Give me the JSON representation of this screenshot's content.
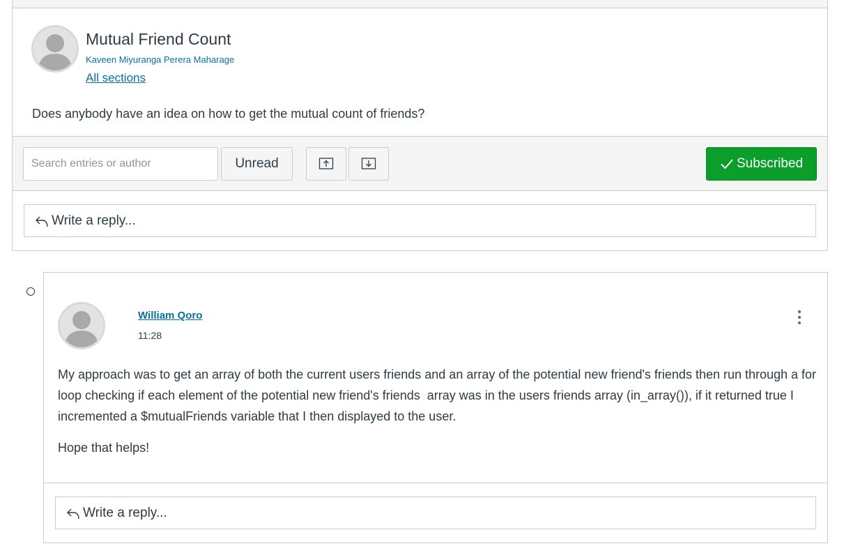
{
  "topic": {
    "title": "Mutual Friend Count",
    "author": "Kaveen Miyuranga Perera Maharage",
    "sections_link": "All sections",
    "message": "Does anybody have an idea on how to get the mutual count of friends?"
  },
  "toolbar": {
    "search_placeholder": "Search entries or author",
    "unread_label": "Unread",
    "subscribed_label": "Subscribed",
    "subscribed_color": "#0b9e2a"
  },
  "topic_reply": {
    "label": "Write a reply..."
  },
  "entry": {
    "author": "William Qoro",
    "time": "11:28",
    "paragraphs": [
      "My approach was to get an array of both the current users friends and an array of the potential new friend's friends then run through a for loop checking if each element of the potential new friend's friends  array was in the users friends array (in_array()), if it returned true I incremented a $mutualFriends variable that I then displayed to the user.",
      "Hope that helps!"
    ],
    "reply_label": "Write a reply..."
  },
  "icons": {
    "avatar": "person-silhouette-icon",
    "upload": "arrow-up-box-icon",
    "download": "arrow-down-box-icon",
    "check": "checkmark-icon",
    "reply": "reply-arrow-icon",
    "menu": "kebab-menu-icon"
  },
  "colors": {
    "link": "#0770a3",
    "text": "#2d3b45",
    "border": "#c7cdd1"
  }
}
